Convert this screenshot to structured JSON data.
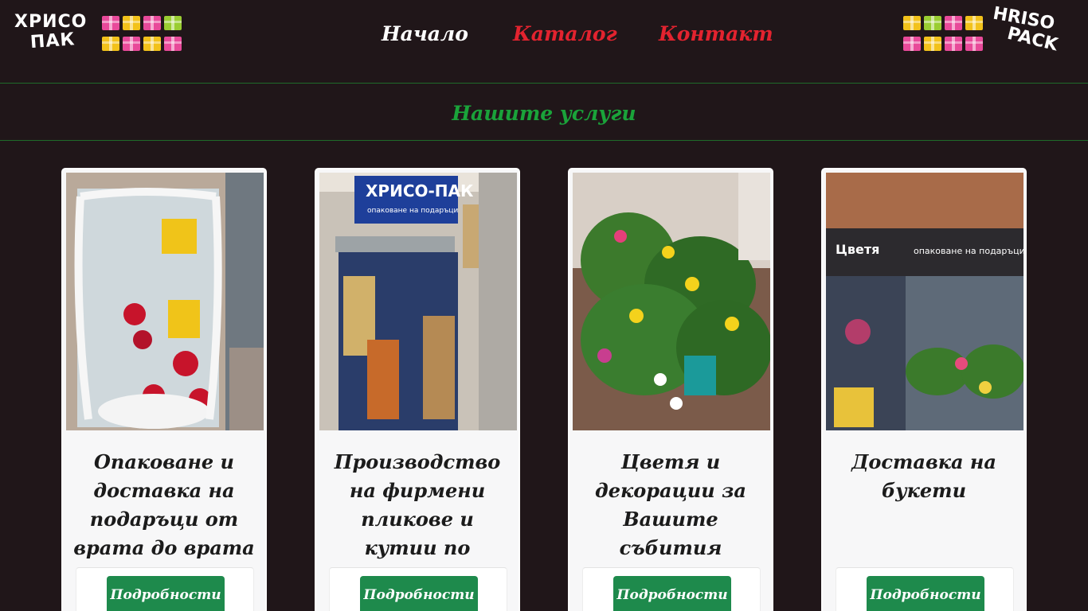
{
  "logos": {
    "left_line1": "ХРИСО",
    "left_line2": "ПАК",
    "right_line1": "HRISO",
    "right_line2": "PACK"
  },
  "nav": {
    "home": "Начало",
    "catalog": "Каталог",
    "contact": "Контакт"
  },
  "services": {
    "title": "Нашите услуги"
  },
  "cards": [
    {
      "title": "Опаковане и доставка на подаръци от врата до врата",
      "button": "Подробности"
    },
    {
      "title": "Производство на фирмени пликове и кутии по поръчка",
      "button": "Подробности"
    },
    {
      "title": "Цветя и декорации за Вашите събития",
      "button": "Подробности"
    },
    {
      "title": "Доставка на букети",
      "button": "Подробности"
    }
  ],
  "colors": {
    "background": "#201619",
    "nav_active": "#ffffff",
    "nav_link": "#e3232f",
    "services_title": "#1aa33a",
    "button": "#1e8a4c"
  },
  "images": {
    "card1": "christmas-window-display",
    "card2": "hriso-pak-shop-front",
    "card3": "flower-arrangements",
    "card4": "flower-shop-front"
  },
  "card2_sign": "ХРИСО-ПАК",
  "card2_sign_sub": "опаковане на подаръци",
  "card4_sign": "Цветя",
  "card4_sign_sub": "опаковане на подаръци"
}
